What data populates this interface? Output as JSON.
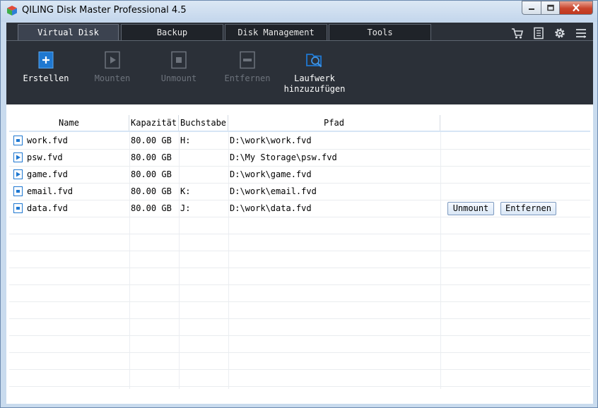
{
  "window": {
    "title": "QILING Disk Master Professional 4.5"
  },
  "tabs": [
    {
      "label": "Virtual Disk",
      "active": true
    },
    {
      "label": "Backup",
      "active": false
    },
    {
      "label": "Disk Management",
      "active": false
    },
    {
      "label": "Tools",
      "active": false
    }
  ],
  "header_icons": [
    "cart-icon",
    "notes-icon",
    "gear-icon",
    "menu-icon"
  ],
  "toolbar": [
    {
      "label": "Erstellen",
      "icon": "create-disk-icon",
      "enabled": true
    },
    {
      "label": "Mounten",
      "icon": "mount-icon",
      "enabled": false
    },
    {
      "label": "Unmount",
      "icon": "unmount-icon",
      "enabled": false
    },
    {
      "label": "Entfernen",
      "icon": "remove-icon",
      "enabled": false
    },
    {
      "label": "Laufwerk\nhinzuzufügen",
      "label_line1": "Laufwerk",
      "label_line2": "hinzuzufügen",
      "icon": "add-drive-icon",
      "enabled": true
    }
  ],
  "table": {
    "columns": [
      "Name",
      "Kapazität",
      "Buchstabe",
      "Pfad",
      ""
    ],
    "rows": [
      {
        "name": "work.fvd",
        "capacity": "80.00 GB",
        "letter": "H:",
        "path": "D:\\work\\work.fvd",
        "icon": "disk-mounted-icon"
      },
      {
        "name": "psw.fvd",
        "capacity": "80.00 GB",
        "letter": "",
        "path": "D:\\My Storage\\psw.fvd",
        "icon": "disk-unmounted-icon"
      },
      {
        "name": "game.fvd",
        "capacity": "80.00 GB",
        "letter": "",
        "path": "D:\\work\\game.fvd",
        "icon": "disk-unmounted-icon"
      },
      {
        "name": "email.fvd",
        "capacity": "80.00 GB",
        "letter": "K:",
        "path": "D:\\work\\email.fvd",
        "icon": "disk-mounted-icon"
      },
      {
        "name": "data.fvd",
        "capacity": "80.00 GB",
        "letter": "J:",
        "path": "D:\\work\\data.fvd",
        "icon": "disk-mounted-icon",
        "actions": [
          "Unmount",
          "Entfernen"
        ]
      }
    ]
  },
  "colors": {
    "accent": "#1f78d1",
    "toolbar_bg": "#2b3038",
    "window_frame": "#c9dbee"
  }
}
